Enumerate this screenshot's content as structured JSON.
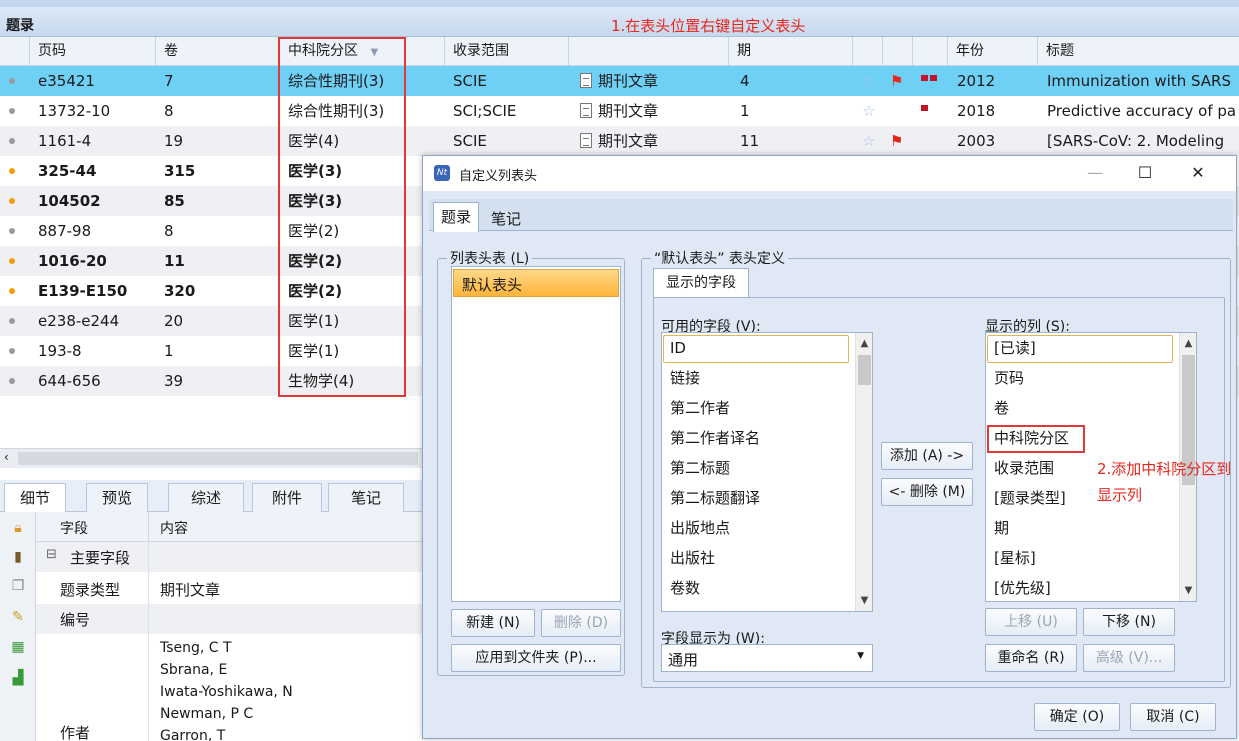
{
  "panel_title": "题录",
  "annotation1": "1.在表头位置右键自定义表头",
  "annotation2": "2.添加中科院分区到显示列",
  "columns": {
    "page": "页码",
    "volume": "卷",
    "cas_zone": "中科院分区",
    "indexed": "收录范围",
    "issue": "期",
    "year": "年份",
    "title": "标题"
  },
  "rows": [
    {
      "read": "read",
      "page": "e35421",
      "volume": "7",
      "zone": "综合性期刊(3)",
      "indexed": "SCIE",
      "type": "期刊文章",
      "issue": "4",
      "star": true,
      "flag": true,
      "prio": 2,
      "year": "2012",
      "title": "Immunization with SARS",
      "bold": false
    },
    {
      "read": "read",
      "page": "13732-10",
      "volume": "8",
      "zone": "综合性期刊(3)",
      "indexed": "SCI;SCIE",
      "type": "期刊文章",
      "issue": "1",
      "star": true,
      "flag": false,
      "prio": 1,
      "year": "2018",
      "title": "Predictive accuracy of pa",
      "bold": false
    },
    {
      "read": "read",
      "page": "1161-4",
      "volume": "19",
      "zone": "医学(4)",
      "indexed": "SCIE",
      "type": "期刊文章",
      "issue": "11",
      "star": true,
      "flag": true,
      "prio": 0,
      "year": "2003",
      "title": "[SARS-CoV: 2. Modeling",
      "bold": false
    },
    {
      "read": "unread",
      "page": "325-44",
      "volume": "315",
      "zone": "医学(3)",
      "bold": true
    },
    {
      "read": "unread",
      "page": "104502",
      "volume": "85",
      "zone": "医学(3)",
      "bold": true
    },
    {
      "read": "read",
      "page": "887-98",
      "volume": "8",
      "zone": "医学(2)",
      "bold": false
    },
    {
      "read": "unread",
      "page": "1016-20",
      "volume": "11",
      "zone": "医学(2)",
      "bold": true
    },
    {
      "read": "unread",
      "page": "E139-E150",
      "volume": "320",
      "zone": "医学(2)",
      "bold": true
    },
    {
      "read": "read",
      "page": "e238-e244",
      "volume": "20",
      "zone": "医学(1)",
      "bold": false
    },
    {
      "read": "read",
      "page": "193-8",
      "volume": "1",
      "zone": "医学(1)",
      "bold": false
    },
    {
      "read": "read",
      "page": "644-656",
      "volume": "39",
      "zone": "生物学(4)",
      "bold": false
    }
  ],
  "bottom_tabs": [
    "细节",
    "预览",
    "综述",
    "附件",
    "笔记"
  ],
  "details": {
    "h_field": "字段",
    "h_content": "内容",
    "group": "主要字段",
    "type_label": "题录类型",
    "type_value": "期刊文章",
    "number_label": "编号",
    "author_label": "作者",
    "authors": [
      "Tseng, C T",
      "Sbrana, E",
      "Iwata-Yoshikawa, N",
      "Newman, P C",
      "Garron, T"
    ]
  },
  "dialog": {
    "title": "自定义列表头",
    "tabs": [
      "题录",
      "笔记"
    ],
    "list_header_label": "列表头表 (L)",
    "list_items": [
      "默认表头"
    ],
    "definition_label": "“默认表头” 表头定义",
    "fields_tab": "显示的字段",
    "available_label": "可用的字段 (V):",
    "available": [
      "ID",
      "链接",
      "第二作者",
      "第二作者译名",
      "第二标题",
      "第二标题翻译",
      "出版地点",
      "出版社",
      "卷数"
    ],
    "shown_label": "显示的列 (S):",
    "shown": [
      "[已读]",
      "页码",
      "卷",
      "中科院分区",
      "收录范围",
      "[题录类型]",
      "期",
      "[星标]",
      "[优先级]"
    ],
    "add_btn": "添加 (A) ->",
    "remove_btn": "<- 删除 (M)",
    "new_btn": "新建 (N)",
    "delete_btn": "删除 (D)",
    "apply_btn": "应用到文件夹 (P)...",
    "display_as_label": "字段显示为 (W):",
    "display_as_value": "通用",
    "up_btn": "上移 (U)",
    "down_btn": "下移 (N)",
    "rename_btn": "重命名 (R)",
    "advanced_btn": "高级 (V)...",
    "ok_btn": "确定 (O)",
    "cancel_btn": "取消 (C)"
  }
}
